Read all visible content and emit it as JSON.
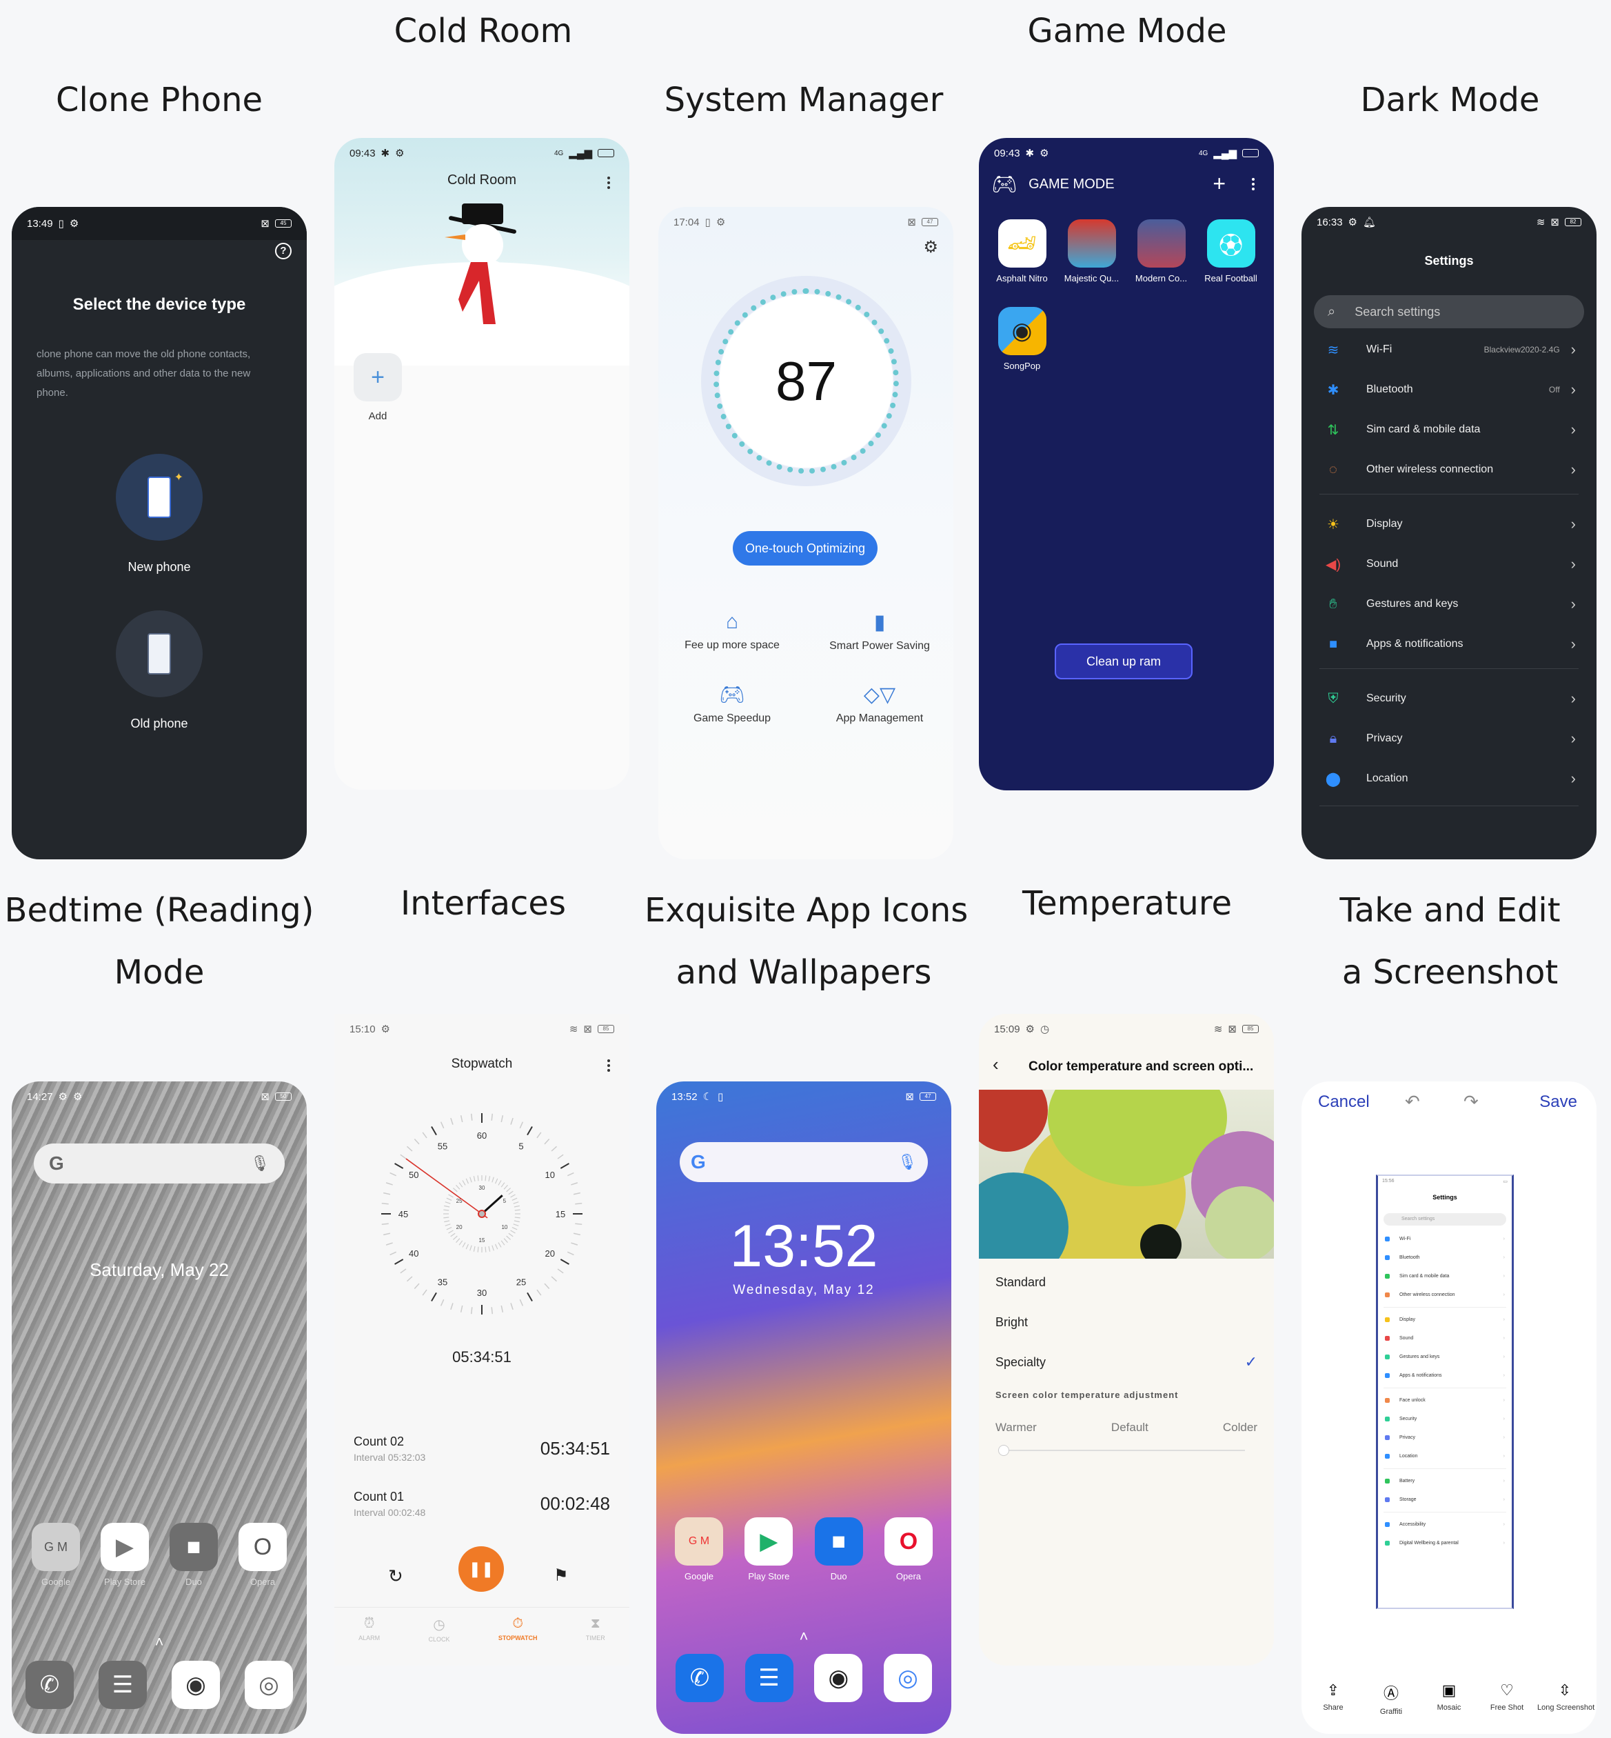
{
  "headings": {
    "clone_phone": "Clone Phone",
    "cold_room": "Cold Room",
    "system_manager": "System Manager",
    "game_mode": "Game Mode",
    "dark_mode": "Dark Mode",
    "bedtime_line1": "Bedtime (Reading)",
    "bedtime_line2": "Mode",
    "interfaces": "Interfaces",
    "icons_line1": "Exquisite App Icons",
    "icons_line2": "and Wallpapers",
    "temperature": "Temperature",
    "screenshot_line1": "Take and Edit",
    "screenshot_line2": "a Screenshot"
  },
  "clone": {
    "time": "13:49",
    "battery": "45",
    "title": "Select the device type",
    "description": "clone phone can move the old phone contacts, albums, applications and other data to the new phone.",
    "new_phone": "New phone",
    "old_phone": "Old phone"
  },
  "cold": {
    "time": "09:43",
    "network": "4G",
    "title": "Cold Room",
    "add_label": "Add"
  },
  "sys": {
    "time": "17:04",
    "battery": "47",
    "score": "87",
    "optimize_button": "One-touch Optimizing",
    "tools": [
      {
        "label": "Fee up more space",
        "icon": "broom-icon"
      },
      {
        "label": "Smart Power Saving",
        "icon": "battery-icon"
      },
      {
        "label": "Game Speedup",
        "icon": "gamepad-icon"
      },
      {
        "label": "App Management",
        "icon": "apps-icon"
      }
    ]
  },
  "game": {
    "time": "09:43",
    "network": "4G",
    "title": "GAME MODE",
    "games": [
      "Asphalt Nitro",
      "Majestic Qu...",
      "Modern Co...",
      "Real Football",
      "SongPop"
    ],
    "clean_button": "Clean up ram"
  },
  "dark": {
    "time": "16:33",
    "battery": "82",
    "title": "Settings",
    "search_placeholder": "Search settings",
    "items": [
      {
        "label": "Wi-Fi",
        "value": "Blackview2020-2.4G"
      },
      {
        "label": "Bluetooth",
        "value": "Off"
      },
      {
        "label": "Sim card & mobile data",
        "value": ""
      },
      {
        "label": "Other wireless connection",
        "value": ""
      },
      {
        "label": "Display",
        "value": ""
      },
      {
        "label": "Sound",
        "value": ""
      },
      {
        "label": "Gestures and keys",
        "value": ""
      },
      {
        "label": "Apps & notifications",
        "value": ""
      },
      {
        "label": "Security",
        "value": ""
      },
      {
        "label": "Privacy",
        "value": ""
      },
      {
        "label": "Location",
        "value": ""
      }
    ]
  },
  "bed": {
    "time": "14:27",
    "battery": "50",
    "date": "Saturday, May 22",
    "apps": [
      "Google",
      "Play Store",
      "Duo",
      "Opera"
    ]
  },
  "stopwatch": {
    "time": "15:10",
    "battery": "85",
    "title": "Stopwatch",
    "dial_labels": [
      "60",
      "5",
      "10",
      "15",
      "20",
      "25",
      "30",
      "35",
      "40",
      "45",
      "50",
      "55"
    ],
    "inner_labels": [
      "30",
      "5",
      "10",
      "15",
      "20",
      "25"
    ],
    "elapsed": "05:34:51",
    "laps": [
      {
        "name": "Count 02",
        "interval": "Interval 05:32:03",
        "total": "05:34:51"
      },
      {
        "name": "Count 01",
        "interval": "Interval 00:02:48",
        "total": "00:02:48"
      }
    ],
    "tabs": [
      "ALARM",
      "CLOCK",
      "STOPWATCH",
      "TIMER"
    ],
    "active_tab": "STOPWATCH",
    "accent": "#f07a26"
  },
  "home": {
    "time": "13:52",
    "battery": "47",
    "clock": "13:52",
    "date": "Wednesday, May 12",
    "apps": [
      "Google",
      "Play Store",
      "Duo",
      "Opera"
    ]
  },
  "temp": {
    "time": "15:09",
    "battery": "85",
    "title": "Color temperature and screen opti...",
    "modes": [
      "Standard",
      "Bright",
      "Specialty"
    ],
    "selected_mode": "Specialty",
    "adjust_title": "Screen color temperature adjustment",
    "slider_labels": [
      "Warmer",
      "Default",
      "Colder"
    ],
    "slider_value": 0
  },
  "shot": {
    "cancel": "Cancel",
    "save": "Save",
    "preview_time": "15:56",
    "preview_title": "Settings",
    "preview_search": "Search settings",
    "preview_items": [
      "Wi-Fi",
      "Bluetooth",
      "Sim card & mobile data",
      "Other wireless connection",
      "Display",
      "Sound",
      "Gestures and keys",
      "Apps & notifications",
      "Face unlock",
      "Security",
      "Privacy",
      "Location",
      "Battery",
      "Storage",
      "Accessibility",
      "Digital Wellbeing & parental"
    ],
    "tools": [
      "Share",
      "Graffiti",
      "Mosaic",
      "Free Shot",
      "Long Screenshot"
    ],
    "accent": "#2b3fb8"
  }
}
